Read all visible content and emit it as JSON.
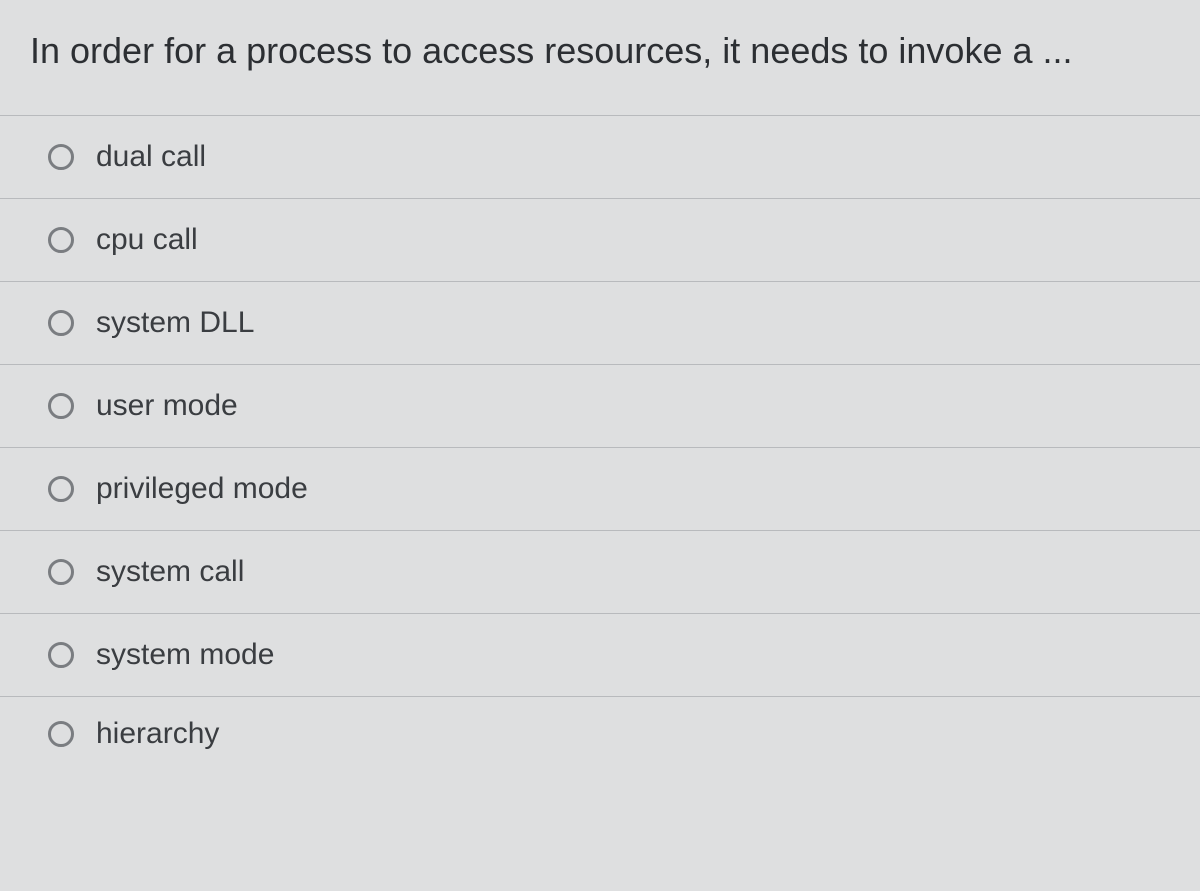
{
  "question": {
    "text": "In order for a process to access resources, it needs to invoke a ..."
  },
  "options": [
    {
      "label": "dual call"
    },
    {
      "label": "cpu call"
    },
    {
      "label": "system DLL"
    },
    {
      "label": "user mode"
    },
    {
      "label": "privileged mode"
    },
    {
      "label": "system call"
    },
    {
      "label": "system mode"
    },
    {
      "label": "hierarchy"
    }
  ]
}
